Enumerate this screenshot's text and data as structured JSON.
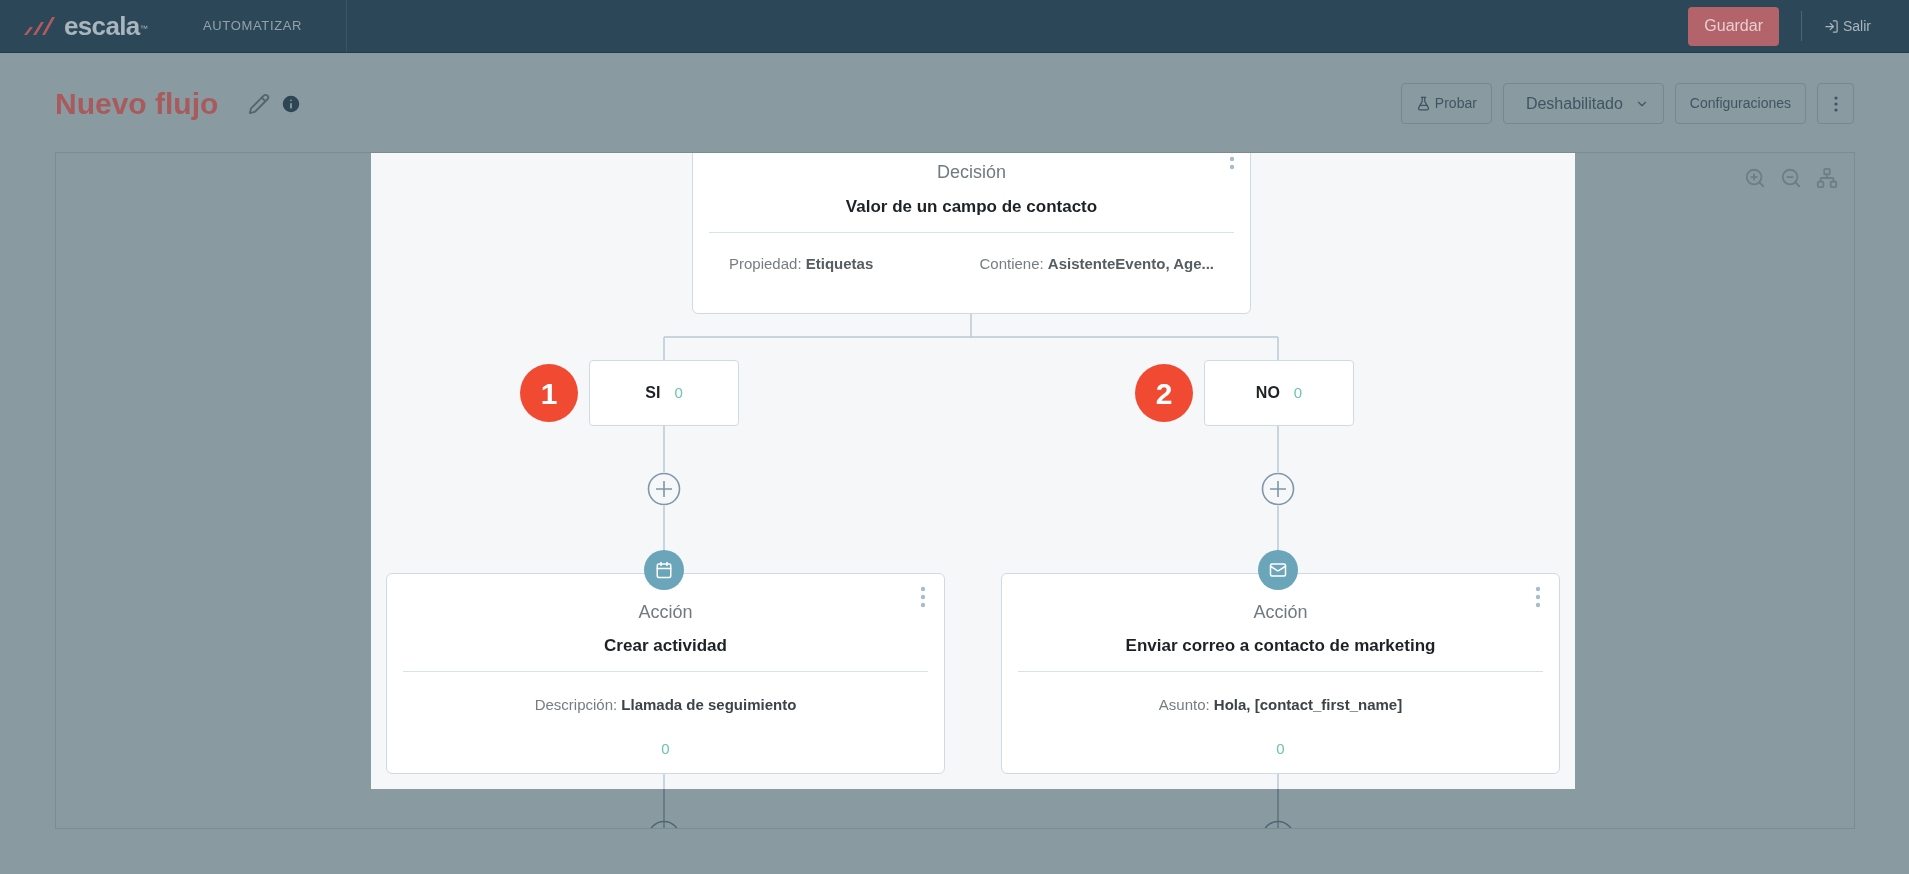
{
  "header": {
    "logo": "escala",
    "logo_mark": "™",
    "section": "AUTOMATIZAR",
    "save_button": "Guardar",
    "exit_link": "Salir"
  },
  "title_bar": {
    "title": "Nuevo flujo",
    "buttons": [
      {
        "label": "Probar",
        "kind": "test"
      },
      {
        "label": "Deshabilitado",
        "kind": "dropdown"
      },
      {
        "label": "Configuraciones",
        "kind": "plain"
      }
    ]
  },
  "flow": {
    "decision": {
      "type": "Decisión",
      "title": "Valor de un campo de contacto",
      "properties": [
        {
          "label": "Propiedad:",
          "value": "Etiquetas"
        },
        {
          "label": "Contiene:",
          "value": "AsistenteEvento, Age..."
        }
      ]
    },
    "branches": [
      {
        "label": "SI",
        "count": "0",
        "marker": "1",
        "action": {
          "kind": "activity",
          "type": "Acción",
          "title": "Crear actividad",
          "detail_label": "Descripción:",
          "detail_value": "Llamada de seguimiento",
          "count": "0"
        }
      },
      {
        "label": "NO",
        "count": "0",
        "marker": "2",
        "action": {
          "kind": "email",
          "type": "Acción",
          "title": "Enviar correo a contacto de marketing",
          "detail_label": "Asunto:",
          "detail_value": "Hola, [contact_first_name]",
          "count": "0"
        }
      }
    ]
  }
}
